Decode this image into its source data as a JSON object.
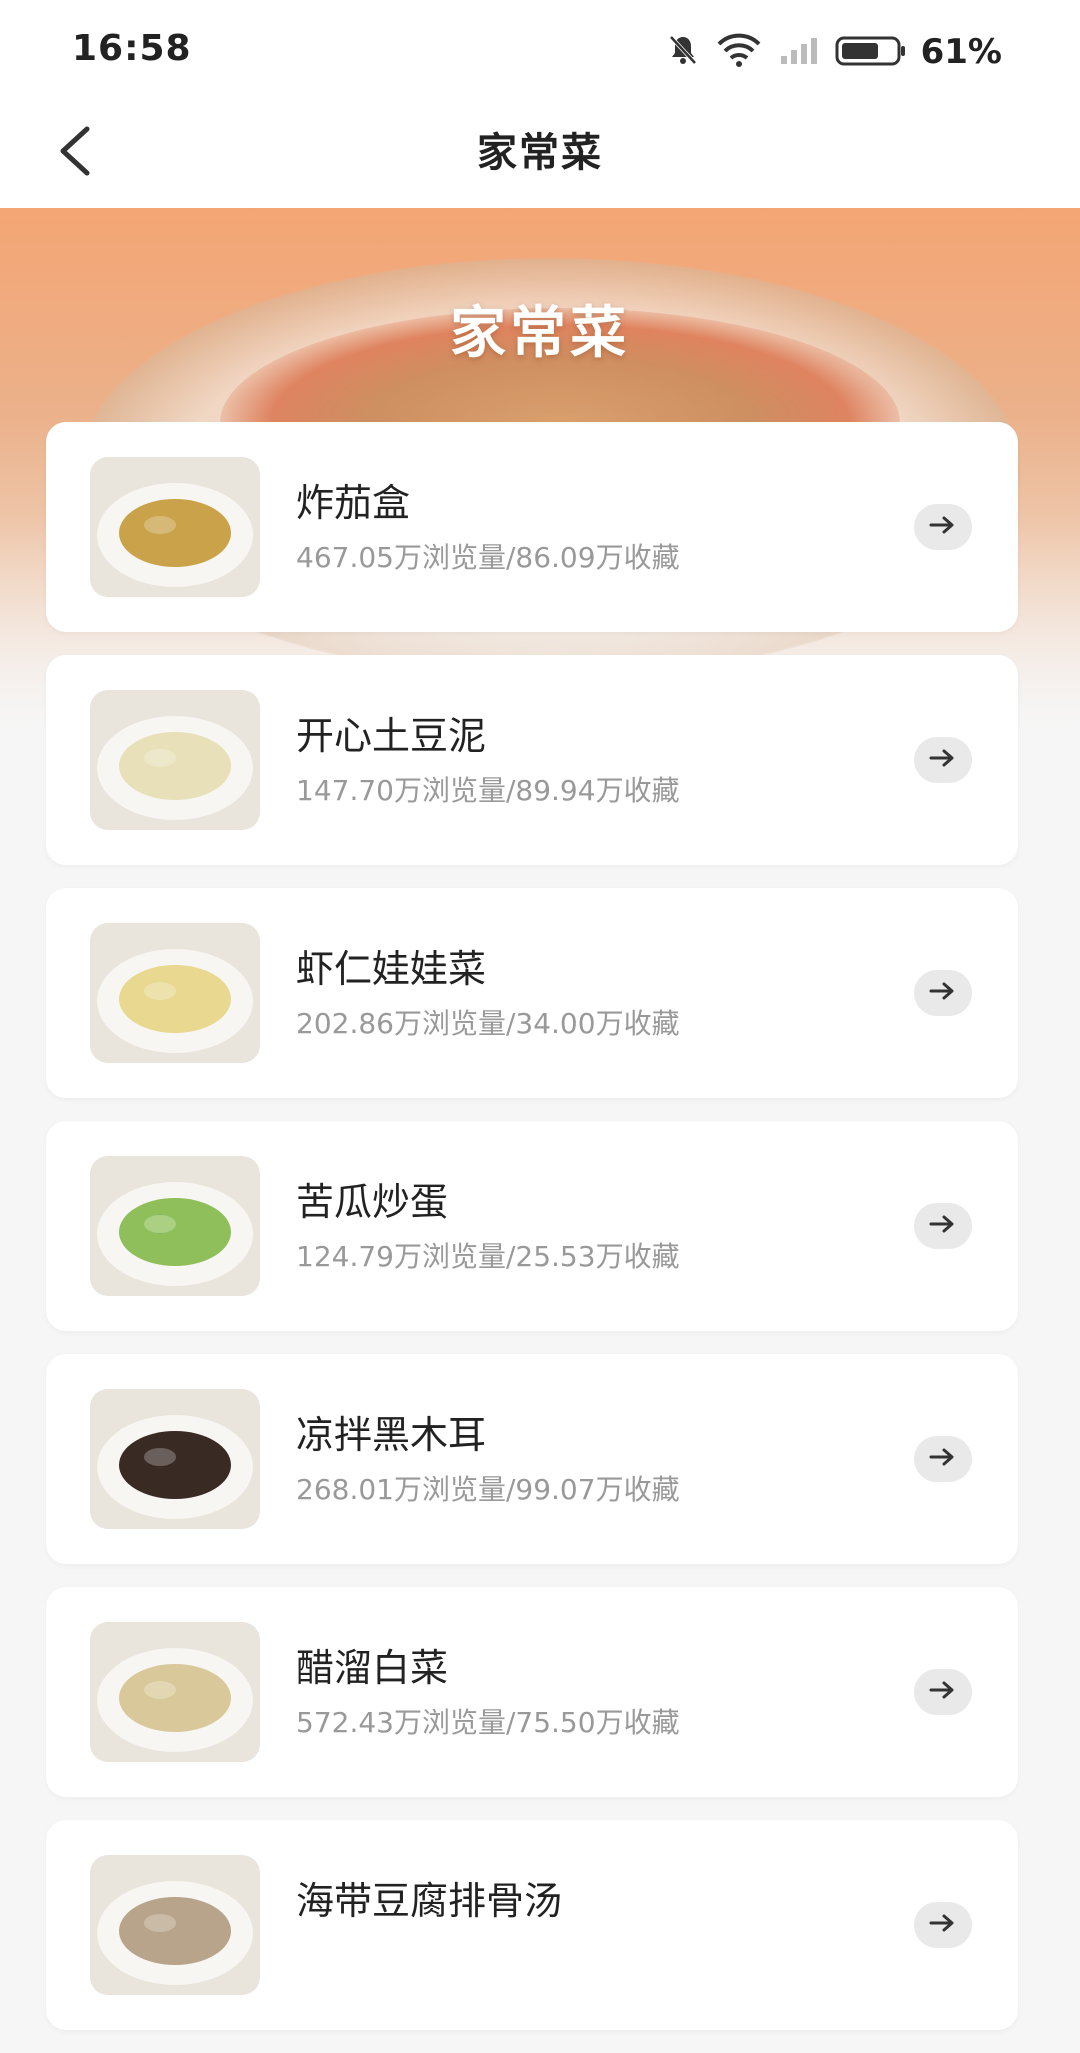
{
  "status_bar": {
    "time": "16:58",
    "battery": "61%",
    "icons": [
      "bell-off-icon",
      "wifi-icon",
      "signal-icon",
      "battery-icon"
    ]
  },
  "nav": {
    "title": "家常菜",
    "back_icon": "chevron-left-icon"
  },
  "banner": {
    "title": "家常菜"
  },
  "dishes": [
    {
      "name": "炸茄盒",
      "stats": "467.05万浏览量/86.09万收藏",
      "color": "#c9a24a"
    },
    {
      "name": "开心土豆泥",
      "stats": "147.70万浏览量/89.94万收藏",
      "color": "#e8e0b8"
    },
    {
      "name": "虾仁娃娃菜",
      "stats": "202.86万浏览量/34.00万收藏",
      "color": "#e9d890"
    },
    {
      "name": "苦瓜炒蛋",
      "stats": "124.79万浏览量/25.53万收藏",
      "color": "#8fbf5a"
    },
    {
      "name": "凉拌黑木耳",
      "stats": "268.01万浏览量/99.07万收藏",
      "color": "#3a2a24"
    },
    {
      "name": "醋溜白菜",
      "stats": "572.43万浏览量/75.50万收藏",
      "color": "#d8c89a"
    },
    {
      "name": "海带豆腐排骨汤",
      "stats": "",
      "color": "#b8a48a"
    }
  ]
}
